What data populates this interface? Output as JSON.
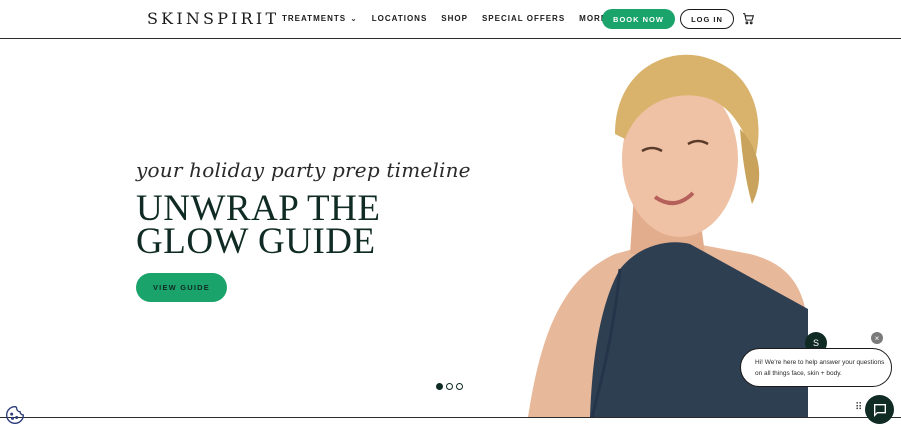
{
  "brand": {
    "logo": "SKINSPIRIT"
  },
  "nav": {
    "treatments": "TREATMENTS",
    "locations": "LOCATIONS",
    "shop": "SHOP",
    "special_offers": "SPECIAL OFFERS",
    "more": "MORE"
  },
  "header_actions": {
    "book_now": "BOOK NOW",
    "log_in": "LOG IN",
    "cart_icon": "cart-icon"
  },
  "hero": {
    "tagline": "your holiday party prep timeline",
    "headline_line1": "UNWRAP THE",
    "headline_line2": "GLOW GUIDE",
    "cta": "VIEW GUIDE",
    "carousel": {
      "slides": 3,
      "active_index": 0
    }
  },
  "chat": {
    "message": "Hi! We're here to help answer your questions on all things face, skin + body.",
    "close_label": "×",
    "avatar_initial": "S"
  },
  "colors": {
    "accent_green": "#1aa36a",
    "dark_green": "#0f2b24"
  }
}
